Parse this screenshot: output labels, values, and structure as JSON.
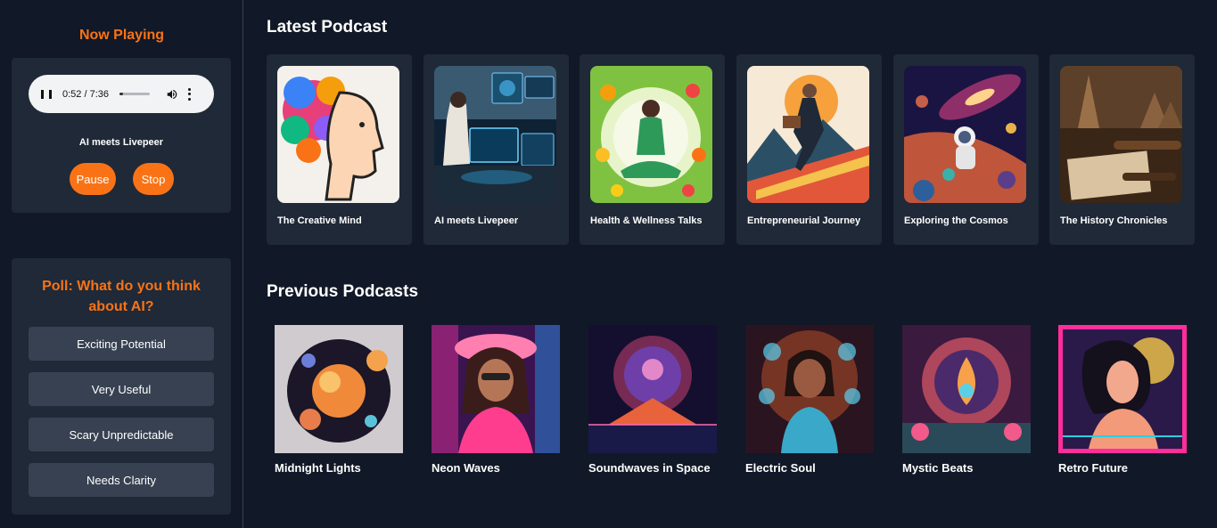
{
  "now_playing": {
    "title": "Now Playing",
    "player": {
      "time": "0:52 / 7:36",
      "progress": 0.114
    },
    "track": "AI meets Livepeer",
    "pause_label": "Pause",
    "stop_label": "Stop"
  },
  "poll": {
    "question": "Poll: What do you think about AI?",
    "options": [
      "Exciting Potential",
      "Very Useful",
      "Scary Unpredictable",
      "Needs Clarity"
    ]
  },
  "latest": {
    "heading": "Latest Podcast",
    "items": [
      {
        "title": "The Creative Mind"
      },
      {
        "title": "AI meets Livepeer"
      },
      {
        "title": "Health & Wellness Talks"
      },
      {
        "title": "Entrepreneurial Journey"
      },
      {
        "title": "Exploring the Cosmos"
      },
      {
        "title": "The History Chronicles"
      }
    ]
  },
  "previous": {
    "heading": "Previous Podcasts",
    "items": [
      {
        "title": "Midnight Lights"
      },
      {
        "title": "Neon Waves"
      },
      {
        "title": "Soundwaves in Space"
      },
      {
        "title": "Electric Soul"
      },
      {
        "title": "Mystic Beats"
      },
      {
        "title": "Retro Future"
      }
    ]
  },
  "colors": {
    "accent": "#f97316",
    "background": "#111827",
    "card": "#1f2937",
    "option": "#374151"
  }
}
